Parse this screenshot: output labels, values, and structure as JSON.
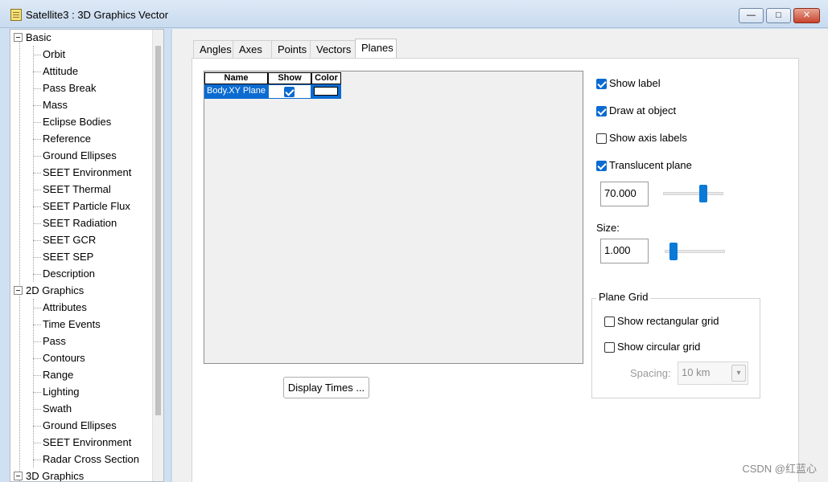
{
  "window": {
    "title": "Satellite3 : 3D Graphics Vector",
    "buttons": {
      "minimize": "—",
      "maximize": "□",
      "close": "✕"
    }
  },
  "tree": {
    "groups": [
      {
        "label": "Basic",
        "children": [
          "Orbit",
          "Attitude",
          "Pass Break",
          "Mass",
          "Eclipse Bodies",
          "Reference",
          "Ground Ellipses",
          "SEET Environment",
          "SEET Thermal",
          "SEET Particle Flux",
          "SEET Radiation",
          "SEET GCR",
          "SEET SEP",
          "Description"
        ]
      },
      {
        "label": "2D Graphics",
        "children": [
          "Attributes",
          "Time Events",
          "Pass",
          "Contours",
          "Range",
          "Lighting",
          "Swath",
          "Ground Ellipses",
          "SEET Environment",
          "Radar Cross Section"
        ]
      },
      {
        "label": "3D Graphics",
        "children": []
      }
    ]
  },
  "tabs": [
    "Angles",
    "Axes",
    "Points",
    "Vectors",
    "Planes"
  ],
  "active_tab": "Planes",
  "grid": {
    "columns": [
      "Name",
      "Show",
      "Color"
    ],
    "rows": [
      {
        "name": "Body.XY Plane",
        "show": true,
        "color": "#ffffff"
      }
    ]
  },
  "buttons": {
    "display_times": "Display Times ..."
  },
  "options": {
    "show_label": "Show label",
    "draw_at_object": "Draw at object",
    "show_axis_labels": "Show axis labels",
    "translucent_plane": "Translucent plane",
    "translucency_value": "70.000",
    "size_label": "Size:",
    "size_value": "1.000"
  },
  "plane_grid": {
    "title": "Plane Grid",
    "show_rectangular": "Show rectangular grid",
    "show_circular": "Show circular grid",
    "spacing_label": "Spacing:",
    "spacing_value": "10 km"
  },
  "watermark": "CSDN @红蓝心"
}
